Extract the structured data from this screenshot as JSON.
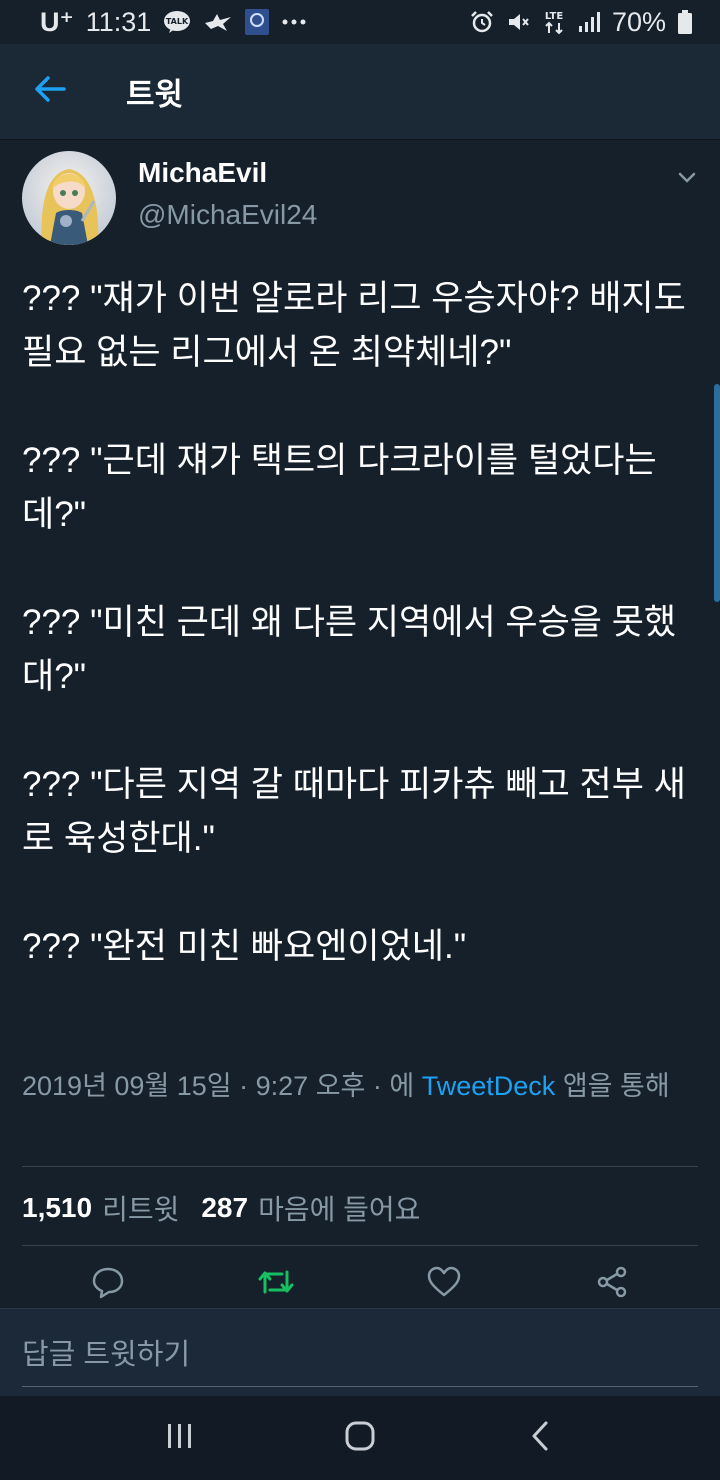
{
  "status_bar": {
    "carrier": "U⁺",
    "time": "11:31",
    "battery": "70%",
    "network": "LTE",
    "icons": [
      "talk-icon",
      "bird-icon",
      "app-icon",
      "more-dots-icon",
      "alarm-icon",
      "mute-icon",
      "lte-icon",
      "signal-icon",
      "battery-icon"
    ]
  },
  "app_bar": {
    "title": "트윗"
  },
  "tweet": {
    "display_name": "MichaEvil",
    "handle": "@MichaEvil24",
    "paragraphs": [
      "??? \"쟤가 이번 알로라 리그 우승자야? 배지도 필요 없는 리그에서 온 최약체네?\"",
      "??? \"근데 쟤가 택트의 다크라이를 털었다는데?\"",
      "??? \"미친 근데 왜 다른 지역에서 우승을 못했대?\"",
      "??? \"다른 지역 갈 때마다 피카츄 빼고 전부 새로 육성한대.\"",
      "??? \"완전 미친 빠요엔이었네.\""
    ],
    "timestamp": "2019년 09월 15일 · 9:27 오후 · 에",
    "source": "TweetDeck",
    "source_suffix": "앱을 통해",
    "retweet_count": "1,510",
    "retweet_label": "리트윗",
    "like_count": "287",
    "like_label": "마음에 들어요"
  },
  "reply": {
    "placeholder": "답글 트윗하기"
  },
  "colors": {
    "background": "#15202b",
    "accent": "#1da1f2",
    "retweet_active": "#17bf63",
    "secondary_text": "#8899a6"
  }
}
